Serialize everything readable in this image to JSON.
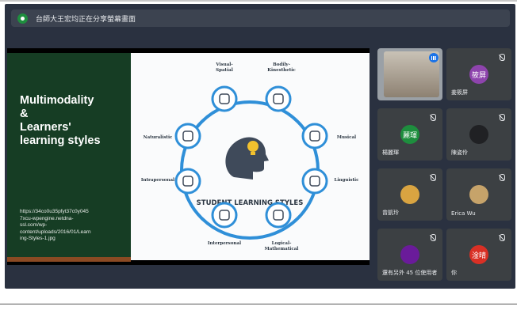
{
  "banner": {
    "text": "台師大王宏均正在分享螢幕畫面"
  },
  "slide": {
    "title": "Multimodality\n&\nLearners'\nlearning styles",
    "url": "https://34co0u35pfyt37c0y045\n7xcu-wpengine.netdna-\nssl.com/wp-\ncontent/uploads/2016/01/Learn\ning-Styles-1.jpg",
    "center_label": "STUDENT LEARNING STYLES",
    "styles": [
      {
        "label": "Visual-\nSpatial",
        "icon": "eye-icon"
      },
      {
        "label": "Bodily-\nKinesthetic",
        "icon": "running-figure-icon"
      },
      {
        "label": "Musical",
        "icon": "music-notes-icon"
      },
      {
        "label": "Linguistic",
        "icon": "speech-bubble-icon"
      },
      {
        "label": "Logical-\nMathematical",
        "icon": "calculator-icon"
      },
      {
        "label": "Interpersonal",
        "icon": "group-icon"
      },
      {
        "label": "Intrapersonal",
        "icon": "head-gears-icon"
      },
      {
        "label": "Naturalistic",
        "icon": "hands-plant-icon"
      }
    ]
  },
  "participants": [
    {
      "name": "",
      "avatar": "",
      "color": "#7a6b5a",
      "video": true,
      "speaking": true
    },
    {
      "name": "姜筱屏",
      "avatar": "筱屏",
      "color": "#8e44ad"
    },
    {
      "name": "楊麗琿",
      "avatar": "麗琿",
      "color": "#1e8e3e"
    },
    {
      "name": "陳姿伶",
      "avatar": "",
      "color": "#202124"
    },
    {
      "name": "曾凱玲",
      "avatar": "",
      "color": "#d9a441"
    },
    {
      "name": "Erica Wu",
      "avatar": "",
      "color": "#c6a36a"
    },
    {
      "name": "還有另外 45 位使用者",
      "avatar": "",
      "color": "#6a1b9a"
    },
    {
      "name": "你",
      "avatar": "淦晴",
      "color": "#d93025"
    }
  ]
}
